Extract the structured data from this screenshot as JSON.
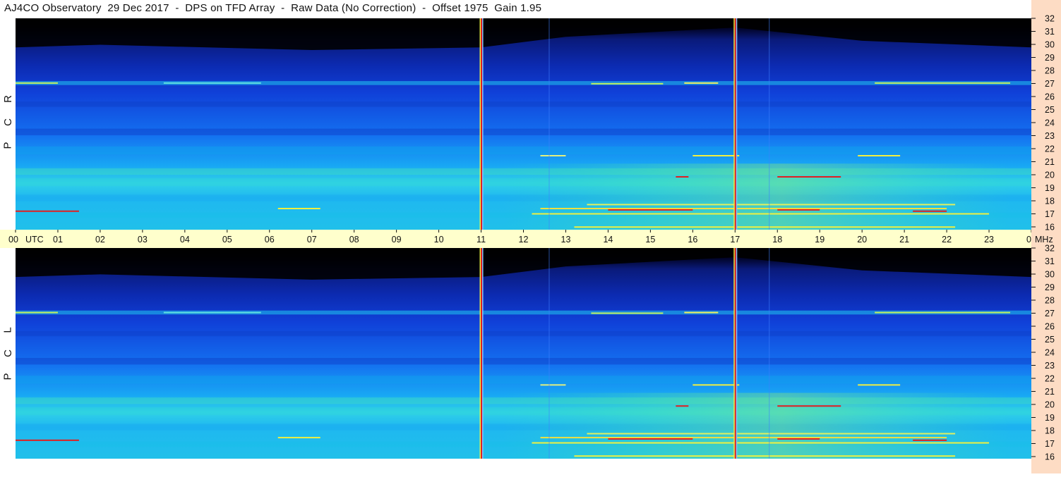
{
  "header": {
    "title": "AJ4CO Observatory  29 Dec 2017  -  DPS on TFD Array  -  Raw Data (No Correction)  -  Offset 1975  Gain 1.95"
  },
  "panels": {
    "rcp_label": [
      "R",
      "C",
      "P"
    ],
    "lcp_label": [
      "L",
      "C",
      "P"
    ]
  },
  "colors": {
    "background_dark": "#000000",
    "deep_blue": "#0a1a8c",
    "blue": "#1060e8",
    "cyan": "#20c8f0",
    "yellow": "#f0f040",
    "red": "#e02020",
    "time_axis_bg": "#ffffcc",
    "freq_axis_bg": "#fddcc4"
  },
  "chart_data": {
    "type": "heatmap",
    "title": "AJ4CO Observatory  29 Dec 2017  -  DPS on TFD Array  -  Raw Data (No Correction)  -  Offset 1975  Gain 1.95",
    "xlabel": "UTC",
    "ylabel": "MHz",
    "x_ticks": [
      "00",
      "01",
      "02",
      "03",
      "04",
      "05",
      "06",
      "07",
      "08",
      "09",
      "10",
      "11",
      "12",
      "13",
      "14",
      "15",
      "16",
      "17",
      "18",
      "19",
      "20",
      "21",
      "22",
      "23",
      "00"
    ],
    "x_unit_label": "UTC",
    "xlim": [
      0,
      24
    ],
    "y_ticks": [
      16,
      17,
      18,
      19,
      20,
      21,
      22,
      23,
      24,
      25,
      26,
      27,
      28,
      29,
      30,
      31,
      32
    ],
    "y_unit_label": "MHz",
    "ylim": [
      16,
      32
    ],
    "panels": [
      "RCP",
      "LCP"
    ],
    "vertical_markers_utc": [
      11,
      17
    ],
    "colormap": [
      "black",
      "deep blue",
      "blue",
      "cyan",
      "yellow",
      "red"
    ]
  }
}
